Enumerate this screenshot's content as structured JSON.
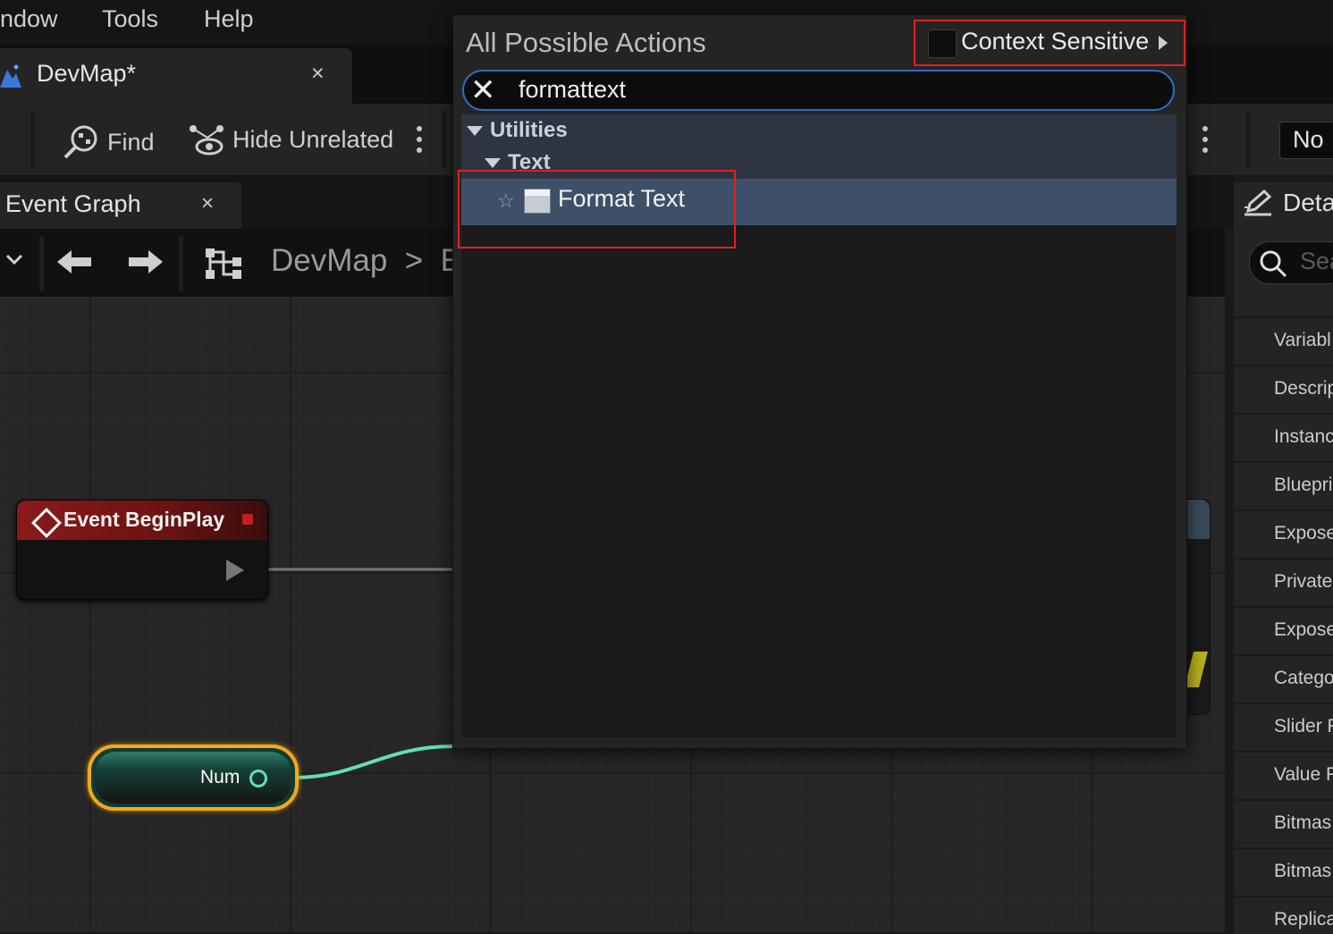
{
  "menubar": {
    "items": [
      "ndow",
      "Tools",
      "Help"
    ]
  },
  "asset_tab": {
    "label": "DevMap*",
    "close": "×"
  },
  "toolbar": {
    "find_label": "Find",
    "hide_unrelated_label": "Hide Unrelated",
    "right_combo": "No"
  },
  "graph_tab": {
    "label": "Event Graph",
    "close": "×"
  },
  "breadcrumb": {
    "text": "DevMap  >  E"
  },
  "nodes": {
    "event_begin_play": "Event BeginPlay",
    "num_variable": "Num"
  },
  "details": {
    "title": "Deta",
    "search_placeholder": "Sea",
    "rows": [
      "Variabl",
      "Descrip",
      "Instanc",
      "Bluepri",
      "Expose",
      "Private",
      "Expose",
      "Catego",
      "Slider F",
      "Value F",
      "Bitmas",
      "Bitmas",
      "Replica"
    ]
  },
  "action_menu": {
    "title": "All Possible Actions",
    "context_sensitive_label": "Context Sensitive",
    "context_sensitive_checked": false,
    "search_value": "formattext",
    "categories": [
      {
        "label": "Utilities",
        "expanded": true
      },
      {
        "label": "Text",
        "expanded": true
      }
    ],
    "result_label": "Format Text"
  },
  "colors": {
    "highlight_box": "#e02020",
    "search_focus": "#2a6fc4",
    "selected_row": "#3e5068",
    "event_header": "#8a1a1a",
    "variable_outline": "#f2a81c",
    "wire_int": "#5fe0b8"
  },
  "icons": [
    "close-icon",
    "find-icon",
    "hide-unrelated-icon",
    "kebab-icon",
    "chevron-down-icon",
    "arrow-left-icon",
    "arrow-right-icon",
    "graph-hierarchy-icon",
    "pencil-icon",
    "search-icon",
    "star-icon",
    "format-text-icon",
    "event-diamond-icon"
  ]
}
